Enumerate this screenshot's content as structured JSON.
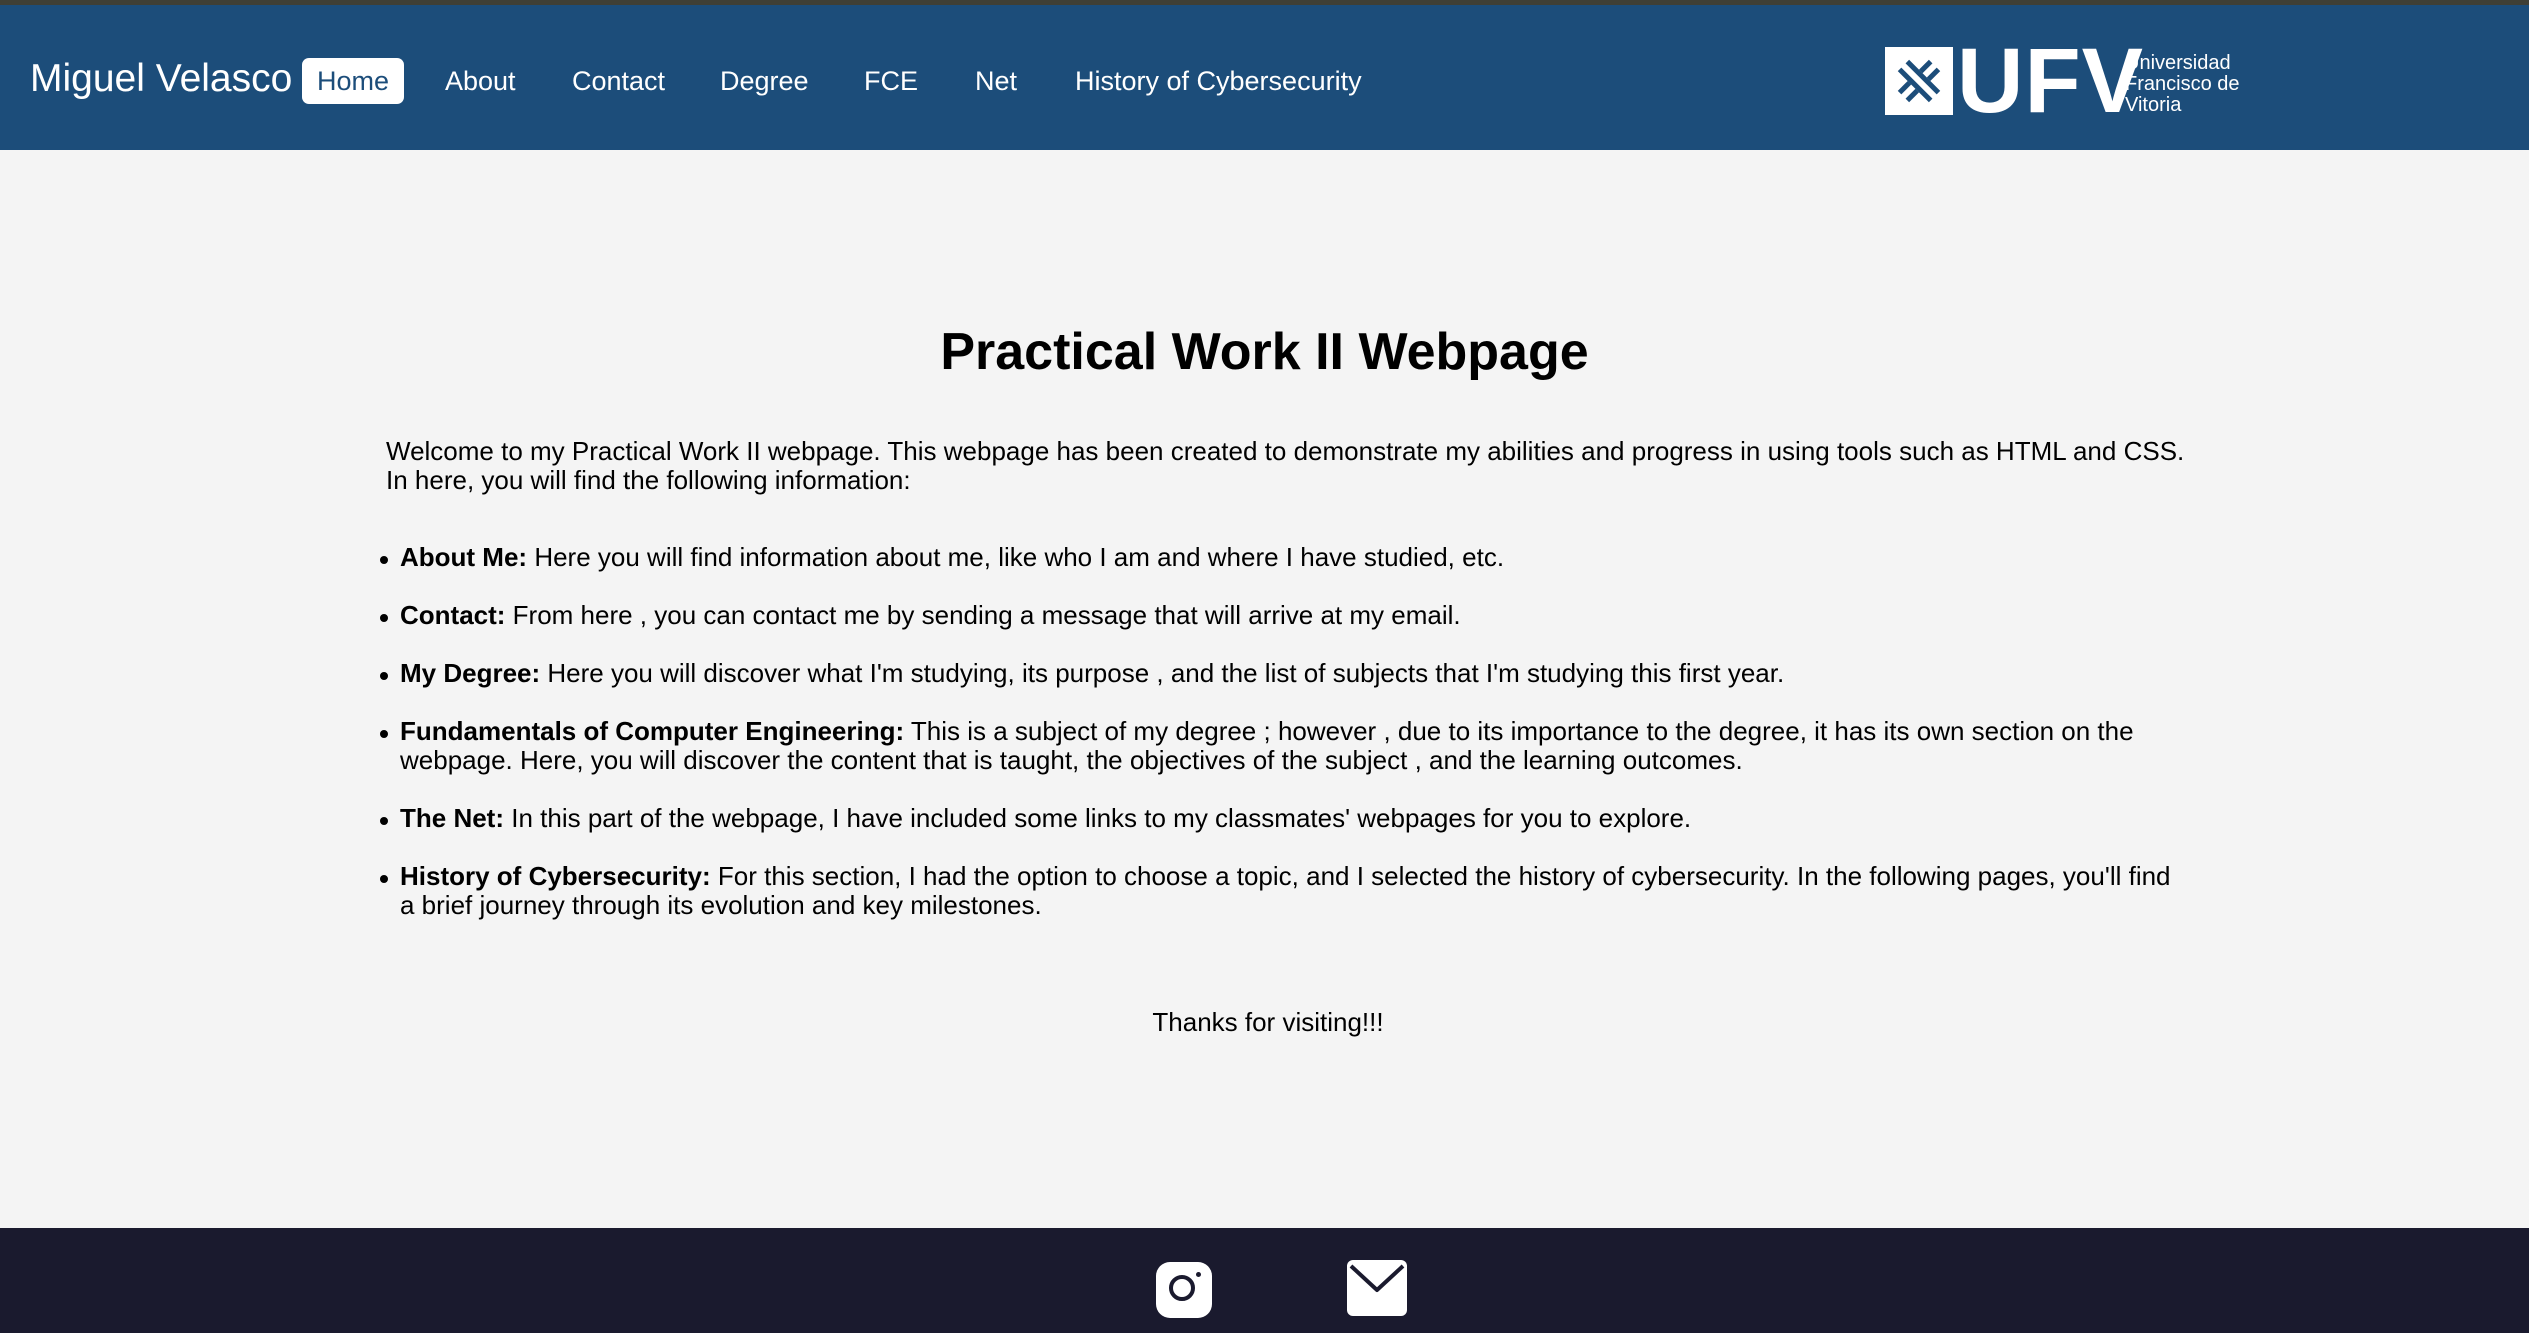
{
  "header": {
    "brand": "Miguel Velasco",
    "nav": [
      {
        "label": "Home",
        "active": true
      },
      {
        "label": "About"
      },
      {
        "label": "Contact"
      },
      {
        "label": "Degree"
      },
      {
        "label": "FCE"
      },
      {
        "label": "Net"
      },
      {
        "label": "History of Cybersecurity"
      }
    ],
    "logo": {
      "letters": "UFV",
      "line1": "Universidad",
      "line2": "Francisco de",
      "line3": "Vitoria"
    }
  },
  "main": {
    "title": "Practical Work II Webpage",
    "intro_line1": "Welcome to my Practical Work II webpage. This webpage has been created to demonstrate my abilities and progress in using tools such as HTML and CSS.",
    "intro_line2": "In here, you will find the following information:",
    "sections": [
      {
        "term": "About Me:",
        "text": " Here you will find information about me, like who I am and where I have studied, etc."
      },
      {
        "term": "Contact:",
        "text": " From here , you can contact me by sending a message that will arrive at my email."
      },
      {
        "term": "My Degree:",
        "text": " Here you will discover what I'm studying, its purpose , and the list of subjects that I'm studying this first year."
      },
      {
        "term": "Fundamentals of Computer Engineering:",
        "text": " This is a subject of my degree ; however , due to its importance to the degree, it has its own section on the webpage. Here, you will discover the content that is taught, the objectives of the subject , and the learning outcomes."
      },
      {
        "term": "The Net:",
        "text": " In this part of the webpage, I have included some links to my classmates' webpages for you to explore."
      },
      {
        "term": "History of Cybersecurity:",
        "text": " For this section, I had the option to choose a topic, and I selected the history of cybersecurity. In the following pages, you'll find a brief journey through its evolution and key milestones."
      }
    ],
    "thanks": "Thanks for visiting!!!"
  },
  "footer": {
    "icons": [
      "instagram-icon",
      "email-icon"
    ]
  },
  "colors": {
    "header_bg": "#1c4d7a",
    "footer_bg": "#1a1a2e",
    "page_bg": "#f4f4f4"
  }
}
